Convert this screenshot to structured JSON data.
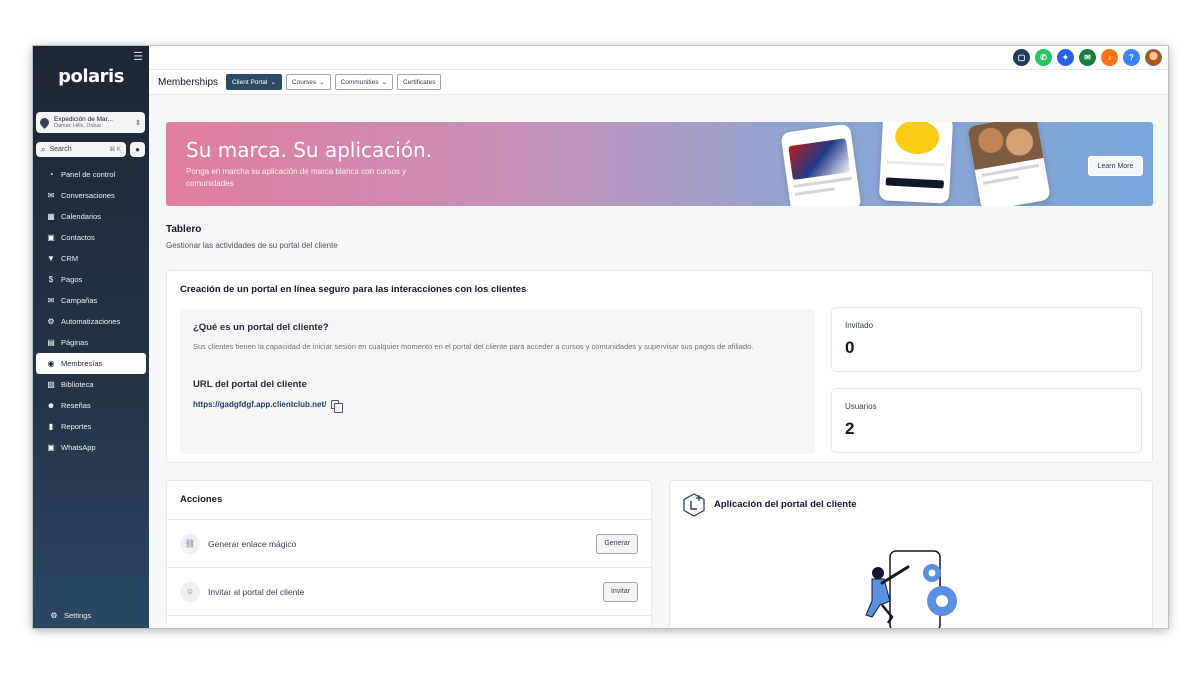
{
  "sidebar": {
    "logo": "polaris",
    "location": {
      "name": "Expedición de Mar...",
      "sub": "Damac Hills, Dubai"
    },
    "search": {
      "label": "Search",
      "shortcut": "⌘ K"
    },
    "items": [
      {
        "label": "Panel de control",
        "icon": "dashboard-icon",
        "glyph": "◔"
      },
      {
        "label": "Conversaciones",
        "icon": "chat-icon",
        "glyph": "✉"
      },
      {
        "label": "Calendarios",
        "icon": "calendar-icon",
        "glyph": "▦"
      },
      {
        "label": "Contactos",
        "icon": "contacts-icon",
        "glyph": "▣"
      },
      {
        "label": "CRM",
        "icon": "funnel-icon",
        "glyph": "▼"
      },
      {
        "label": "Pagos",
        "icon": "payments-icon",
        "glyph": "$"
      },
      {
        "label": "Campañas",
        "icon": "campaigns-icon",
        "glyph": "✉"
      },
      {
        "label": "Automatizaciones",
        "icon": "automation-icon",
        "glyph": "⚙"
      },
      {
        "label": "Páginas",
        "icon": "pages-icon",
        "glyph": "▤"
      },
      {
        "label": "Membresías",
        "icon": "membership-icon",
        "glyph": "◉",
        "active": true
      },
      {
        "label": "Biblioteca",
        "icon": "library-icon",
        "glyph": "▨"
      },
      {
        "label": "Reseñas",
        "icon": "reviews-icon",
        "glyph": "☻"
      },
      {
        "label": "Reportes",
        "icon": "reports-icon",
        "glyph": "▮"
      },
      {
        "label": "WhatsApp",
        "icon": "whatsapp-icon",
        "glyph": "▣"
      }
    ],
    "settings": "Settings"
  },
  "topbar": {
    "icons": [
      {
        "name": "chat-widget-icon",
        "color": "#1e3a5f",
        "glyph": "▢"
      },
      {
        "name": "phone-icon",
        "color": "#22c55e",
        "glyph": "✆"
      },
      {
        "name": "magic-icon",
        "color": "#2563eb",
        "glyph": "✦"
      },
      {
        "name": "megaphone-icon",
        "color": "#15803d",
        "glyph": "✉"
      },
      {
        "name": "bell-icon",
        "color": "#f97316",
        "glyph": "♪"
      },
      {
        "name": "help-icon",
        "color": "#3b82f6",
        "glyph": "?"
      },
      {
        "name": "avatar-icon",
        "color": "#b45309",
        "glyph": "●"
      }
    ]
  },
  "subnav": {
    "title": "Memberships",
    "tabs": [
      {
        "label": "Client Portal",
        "caret": true,
        "active": true
      },
      {
        "label": "Courses",
        "caret": true
      },
      {
        "label": "Communities",
        "caret": true
      },
      {
        "label": "Certificates",
        "caret": false
      }
    ]
  },
  "banner": {
    "title": "Su marca. Su aplicación.",
    "subtitle": "Ponga en marcha su aplicación de marca blanca con cursos y comunidades",
    "button": "Learn More"
  },
  "dashboard": {
    "title": "Tablero",
    "subtitle": "Gestionar las actividades de su portal del cliente"
  },
  "portal": {
    "heading": "Creación de un portal en línea seguro para las interacciones con los clientes",
    "question": "¿Qué es un portal del cliente?",
    "description": "Sus clientes tienen la capacidad de iniciar sesión en cualquier momento en el portal del cliente para acceder a cursos y comunidades y supervisar sus pagos de afiliado.",
    "url_label": "URL del portal del cliente",
    "url": "https://gadgfdgf.app.clientclub.net/",
    "stats": [
      {
        "label": "Invitado",
        "value": "0"
      },
      {
        "label": "Usuarios",
        "value": "2"
      }
    ]
  },
  "actions": {
    "heading": "Acciones",
    "rows": [
      {
        "label": "Generar enlace mágico",
        "button": "Generar"
      },
      {
        "label": "Invitar al portal del cliente",
        "button": "Invitar"
      }
    ]
  },
  "app": {
    "heading": "Aplicación del portal del cliente"
  }
}
